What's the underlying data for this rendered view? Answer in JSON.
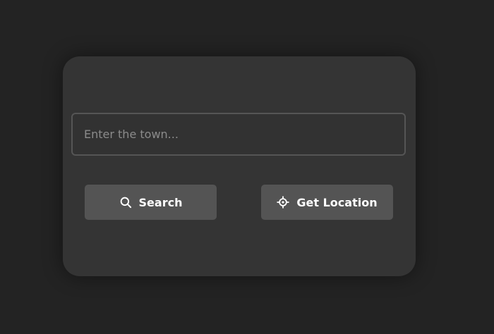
{
  "search": {
    "placeholder": "Enter the town...",
    "value": ""
  },
  "buttons": {
    "search_label": "Search",
    "search_icon": "search-icon",
    "location_label": "Get Location",
    "location_icon": "crosshair-icon"
  },
  "colors": {
    "background": "#232323",
    "card": "#343434",
    "button": "#545454",
    "text": "#ffffff",
    "placeholder": "#8b8b8b"
  }
}
